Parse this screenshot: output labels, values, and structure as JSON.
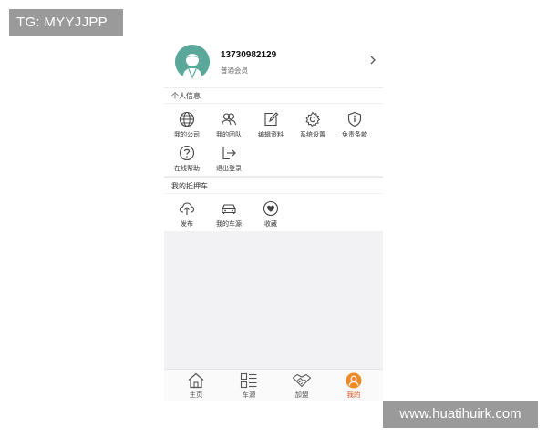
{
  "watermarks": {
    "top_left": "TG: MYYJJPP",
    "bottom_right": "www.huatihuirk.com"
  },
  "profile": {
    "phone": "13730982129",
    "level": "普通会员",
    "avatar_icon": "user-avatar-icon",
    "arrow_icon": "chevron-right-icon",
    "avatar_color": "#5aa89a"
  },
  "personal_info": {
    "title": "个人信息",
    "items": [
      {
        "label": "我的公司",
        "icon": "globe-icon"
      },
      {
        "label": "我的团队",
        "icon": "team-icon"
      },
      {
        "label": "编辑资料",
        "icon": "edit-icon"
      },
      {
        "label": "系统设置",
        "icon": "gear-icon"
      },
      {
        "label": "免责条款",
        "icon": "shield-icon"
      },
      {
        "label": "在线帮助",
        "icon": "help-icon"
      },
      {
        "label": "退出登录",
        "icon": "logout-icon"
      }
    ]
  },
  "mortgage_cars": {
    "title": "我的抵押车",
    "items": [
      {
        "label": "发布",
        "icon": "upload-cloud-icon"
      },
      {
        "label": "我的车源",
        "icon": "car-icon"
      },
      {
        "label": "收藏",
        "icon": "heart-icon"
      }
    ]
  },
  "tabbar": {
    "tabs": [
      {
        "label": "主页",
        "icon": "home-icon"
      },
      {
        "label": "车源",
        "icon": "list-icon"
      },
      {
        "label": "加盟",
        "icon": "handshake-icon"
      },
      {
        "label": "我的",
        "icon": "profile-icon",
        "active": true
      }
    ],
    "active_color": "#e8501e"
  }
}
